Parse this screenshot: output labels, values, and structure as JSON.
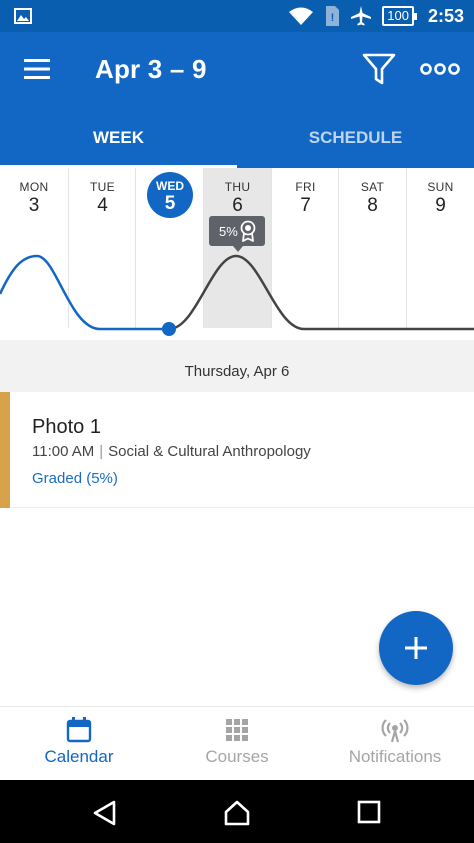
{
  "status_bar": {
    "battery": "100",
    "time": "2:53"
  },
  "app_bar": {
    "title": "Apr 3 – 9",
    "tabs": [
      {
        "label": "WEEK",
        "selected": true
      },
      {
        "label": "SCHEDULE",
        "selected": false
      }
    ]
  },
  "week": {
    "days": [
      {
        "name": "MON",
        "num": "3"
      },
      {
        "name": "TUE",
        "num": "4"
      },
      {
        "name": "WED",
        "num": "5",
        "today": true
      },
      {
        "name": "THU",
        "num": "6",
        "selected": true
      },
      {
        "name": "FRI",
        "num": "7"
      },
      {
        "name": "SAT",
        "num": "8"
      },
      {
        "name": "SUN",
        "num": "9"
      }
    ],
    "badge": {
      "percent": "5%"
    }
  },
  "day_section": {
    "date_label": "Thursday, Apr 6",
    "items": [
      {
        "title": "Photo 1",
        "time": "11:00 AM",
        "course": "Social & Cultural Anthropology",
        "status": "Graded (5%)"
      }
    ]
  },
  "bottom_nav": [
    {
      "label": "Calendar",
      "active": true
    },
    {
      "label": "Courses",
      "active": false
    },
    {
      "label": "Notifications",
      "active": false
    }
  ],
  "colors": {
    "primary": "#1267c4",
    "status_bar": "#0a5eb0",
    "accent_stripe": "#d8a24a",
    "link": "#1a6cc4"
  }
}
